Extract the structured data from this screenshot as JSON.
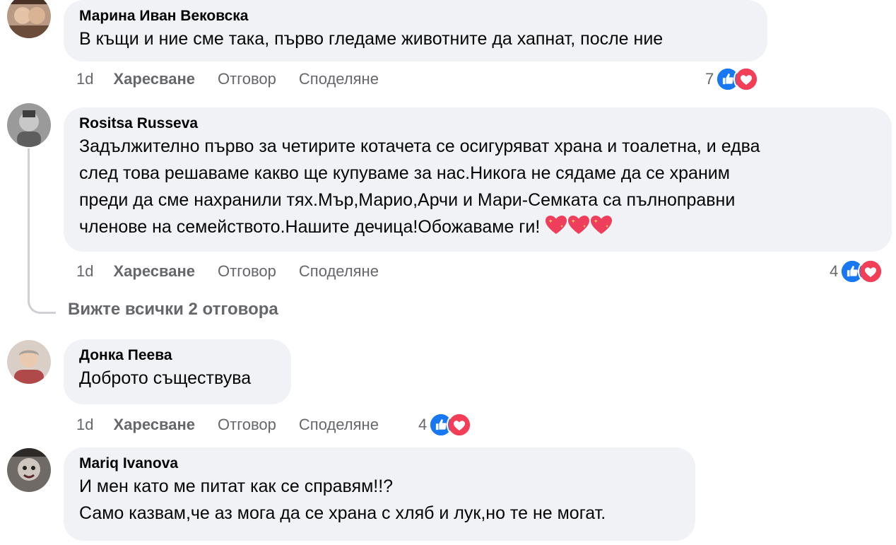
{
  "comments": [
    {
      "author": "Марина Иван Вековска",
      "lines": [
        "В къщи и ние сме така, първо гледаме животните да хапнат, после ние"
      ],
      "time": "1d",
      "like_label": "Харесване",
      "reply_label": "Отговор",
      "share_label": "Споделяне",
      "reaction_count": "7"
    },
    {
      "author": "Rositsa Russeva",
      "lines": [
        "Задължително първо за четирите котачета се осигуряват храна и тоалетна, и едва",
        "след това решаваме какво ще купуваме за нас.Никога не сядаме да се храним",
        "преди да сме нахранили тях.Мър,Марио,Арчи и Мари-Семката са пълноправни",
        "членове на семейството.Нашите дечица!Обожаваме ги!"
      ],
      "emoji": "sparkling-heart-emoji x3",
      "time": "1d",
      "like_label": "Харесване",
      "reply_label": "Отговор",
      "share_label": "Споделяне",
      "reaction_count": "4",
      "see_replies": "Вижте всички 2 отговора"
    },
    {
      "author": "Донка Пеева",
      "lines": [
        "Доброто съществува"
      ],
      "time": "1d",
      "like_label": "Харесване",
      "reply_label": "Отговор",
      "share_label": "Споделяне",
      "reaction_count": "4"
    },
    {
      "author": "Mariq Ivanova",
      "lines": [
        "И мен като ме питат как се справям!!?",
        "Само казвам,че аз мога да се храна с хляб и лук,но те не могат."
      ]
    }
  ],
  "colors": {
    "bubble": "#f0f2f5",
    "secondary_text": "#65676b",
    "like_blue": "#1877f2",
    "love_red": "#f33e58"
  },
  "icons": [
    "like-reaction-icon",
    "love-reaction-icon",
    "sparkling-heart-emoji"
  ]
}
